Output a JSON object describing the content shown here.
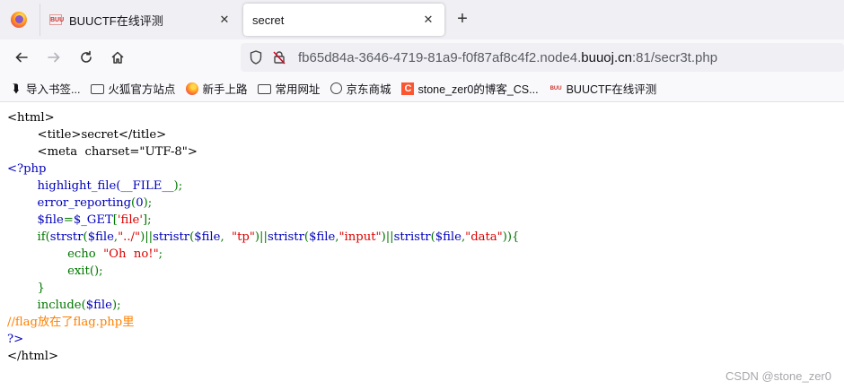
{
  "tabs": [
    {
      "label": "BUUCTF在线评测",
      "favicon": "buuctf-favicon",
      "active": false
    },
    {
      "label": "secret",
      "active": true
    }
  ],
  "new_tab_label": "+",
  "navbar": {
    "url_prefix": "fb65d84a-3646-4719-81a9-f0f87af8c4f2.node4.",
    "url_domain": "buuoj.cn",
    "url_suffix": ":81/secr3t.php"
  },
  "bookmarks": [
    {
      "label": "导入书签...",
      "icon": "import-icon"
    },
    {
      "label": "火狐官方站点",
      "icon": "folder-icon"
    },
    {
      "label": "新手上路",
      "icon": "firefox-icon"
    },
    {
      "label": "常用网址",
      "icon": "folder-icon"
    },
    {
      "label": "京东商城",
      "icon": "globe-icon"
    },
    {
      "label": "stone_zer0的博客_CS...",
      "icon": "csdn-icon"
    },
    {
      "label": "BUUCTF在线评测",
      "icon": "buuctf-icon"
    }
  ],
  "code_lines": [
    [
      {
        "t": "<html>",
        "c": "default"
      }
    ],
    [
      {
        "t": "        <title>secret</title>",
        "c": "default"
      }
    ],
    [
      {
        "t": "        <meta  charset=\"UTF-8\">",
        "c": "default"
      }
    ],
    [
      {
        "t": "<?php",
        "c": "func"
      }
    ],
    [
      {
        "t": "        highlight_file(",
        "c": "func"
      },
      {
        "t": "__FILE__",
        "c": "func"
      },
      {
        "t": ");",
        "c": "keyword"
      }
    ],
    [
      {
        "t": "        error_reporting",
        "c": "func"
      },
      {
        "t": "(",
        "c": "keyword"
      },
      {
        "t": "0",
        "c": "func"
      },
      {
        "t": ");",
        "c": "keyword"
      }
    ],
    [
      {
        "t": "        $file",
        "c": "func"
      },
      {
        "t": "=",
        "c": "keyword"
      },
      {
        "t": "$_GET",
        "c": "func"
      },
      {
        "t": "[",
        "c": "keyword"
      },
      {
        "t": "'file'",
        "c": "string"
      },
      {
        "t": "];",
        "c": "keyword"
      }
    ],
    [
      {
        "t": "        if(",
        "c": "keyword"
      },
      {
        "t": "strstr",
        "c": "func"
      },
      {
        "t": "(",
        "c": "keyword"
      },
      {
        "t": "$file",
        "c": "func"
      },
      {
        "t": ",",
        "c": "keyword"
      },
      {
        "t": "\"../\"",
        "c": "string"
      },
      {
        "t": ")||",
        "c": "keyword"
      },
      {
        "t": "stristr",
        "c": "func"
      },
      {
        "t": "(",
        "c": "keyword"
      },
      {
        "t": "$file",
        "c": "func"
      },
      {
        "t": ",  ",
        "c": "keyword"
      },
      {
        "t": "\"tp\"",
        "c": "string"
      },
      {
        "t": ")||",
        "c": "keyword"
      },
      {
        "t": "stristr",
        "c": "func"
      },
      {
        "t": "(",
        "c": "keyword"
      },
      {
        "t": "$file",
        "c": "func"
      },
      {
        "t": ",",
        "c": "keyword"
      },
      {
        "t": "\"input\"",
        "c": "string"
      },
      {
        "t": ")||",
        "c": "keyword"
      },
      {
        "t": "stristr",
        "c": "func"
      },
      {
        "t": "(",
        "c": "keyword"
      },
      {
        "t": "$file",
        "c": "func"
      },
      {
        "t": ",",
        "c": "keyword"
      },
      {
        "t": "\"data\"",
        "c": "string"
      },
      {
        "t": ")){",
        "c": "keyword"
      }
    ],
    [
      {
        "t": "                echo  ",
        "c": "keyword"
      },
      {
        "t": "\"Oh  no!\"",
        "c": "string"
      },
      {
        "t": ";",
        "c": "keyword"
      }
    ],
    [
      {
        "t": "                exit",
        "c": "keyword"
      },
      {
        "t": "();",
        "c": "keyword"
      }
    ],
    [
      {
        "t": "        }",
        "c": "keyword"
      }
    ],
    [
      {
        "t": "        include",
        "c": "keyword"
      },
      {
        "t": "(",
        "c": "keyword"
      },
      {
        "t": "$file",
        "c": "func"
      },
      {
        "t": ");",
        "c": "keyword"
      }
    ],
    [
      {
        "t": "//flag放在了flag.php里",
        "c": "comment"
      }
    ],
    [
      {
        "t": "?>",
        "c": "func"
      }
    ],
    [
      {
        "t": "</html>",
        "c": "default"
      }
    ]
  ],
  "watermark": "CSDN @stone_zer0"
}
